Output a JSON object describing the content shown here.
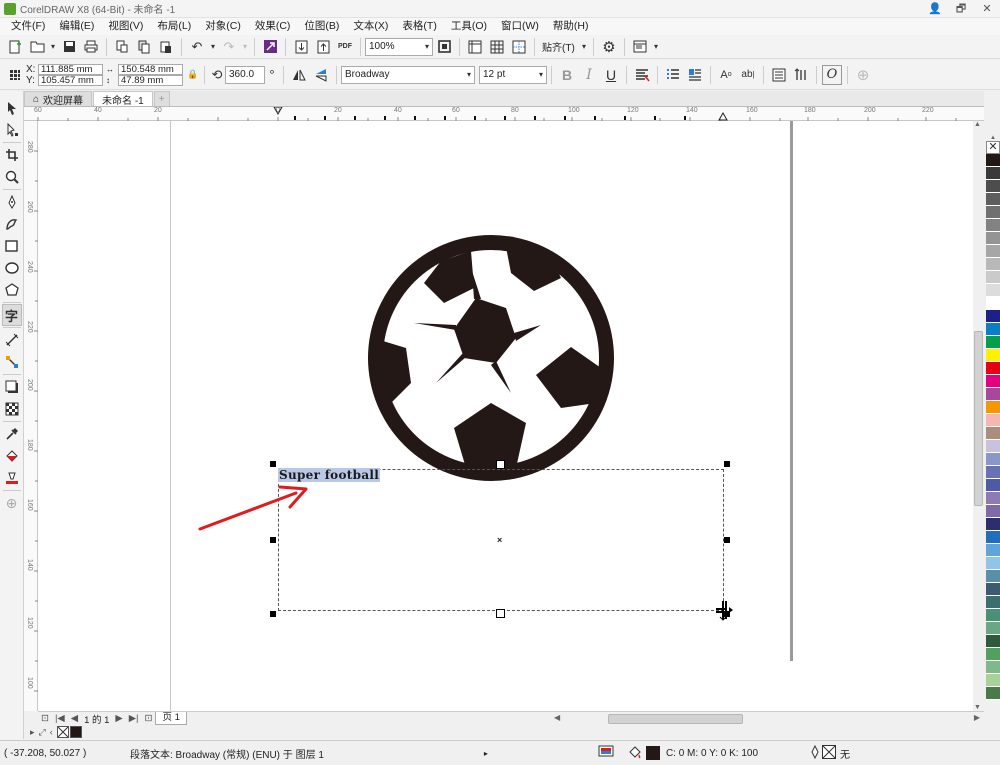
{
  "window": {
    "title": "CorelDRAW X8 (64-Bit) - 未命名 -1",
    "controls": [
      "👤",
      "🗗",
      "✕"
    ]
  },
  "menubar": {
    "items": [
      "文件(F)",
      "编辑(E)",
      "视图(V)",
      "布局(L)",
      "对象(C)",
      "效果(C)",
      "位图(B)",
      "文本(X)",
      "表格(T)",
      "工具(O)",
      "窗口(W)",
      "帮助(H)"
    ]
  },
  "standard_toolbar": {
    "zoom_value": "100%",
    "pdf_label": "PDF",
    "snap_label": "贴齐(T)"
  },
  "property_bar": {
    "x_label": "X:",
    "x_value": "111.885 mm",
    "y_label": "Y:",
    "y_value": "105.457 mm",
    "width_value": "150.548 mm",
    "height_value": "47.89 mm",
    "rotation_value": "360.0",
    "rotation_unit": "°",
    "font_name": "Broadway",
    "font_size": "12 pt",
    "bold_label": "B",
    "italic_label": "I",
    "underline_label": "U"
  },
  "tabs": {
    "welcome": "欢迎屏幕",
    "document": "未命名 -1",
    "add": "+"
  },
  "ruler": {
    "h_labels": [
      "60",
      "40",
      "20",
      "0",
      "20",
      "40",
      "60",
      "80",
      "100",
      "120",
      "140",
      "160",
      "180",
      "200",
      "220"
    ],
    "v_labels": [
      "280",
      "260",
      "240",
      "220",
      "200",
      "180",
      "160",
      "140",
      "120",
      "100"
    ]
  },
  "canvas": {
    "selected_text": "Super football"
  },
  "page_nav": {
    "page_count": "1 的 1",
    "page_tab": "页 1"
  },
  "status": {
    "coordinates": "( -37.208, 50.027 )",
    "object_info": "段落文本: Broadway (常规) (ENU) 于 图层 1",
    "fill_info": "C: 0 M: 0 Y: 0 K: 100",
    "outline_info": "无"
  },
  "colors": {
    "ball": "#231815",
    "arrow": "#e11b1b",
    "selection": "#b8c8e6",
    "palette": [
      "#231815",
      "#3a3a3a",
      "#4d4d4d",
      "#5e5e5e",
      "#707070",
      "#828282",
      "#949494",
      "#a6a6a6",
      "#b8b8b8",
      "#cacaca",
      "#dcdcdc",
      "#ffffff",
      "#1d2088",
      "#0a7fc7",
      "#00a04e",
      "#fff100",
      "#e60012",
      "#e4007f",
      "#a7479e",
      "#f39800",
      "#f8b6b0",
      "#ae8c7c",
      "#c7c2e0",
      "#8a97c9",
      "#6a70b5",
      "#4e5aa8",
      "#8e7ab5",
      "#7f6aa8",
      "#2e2e6e",
      "#1f6ec0",
      "#5fa5dc",
      "#8ec5e8",
      "#5a8fa8",
      "#3d5a73",
      "#3c6e6e",
      "#4a8f78",
      "#6aa884",
      "#2e5a3c",
      "#51a05e",
      "#7fb88a",
      "#a9d19a",
      "#4a7a4a"
    ]
  }
}
